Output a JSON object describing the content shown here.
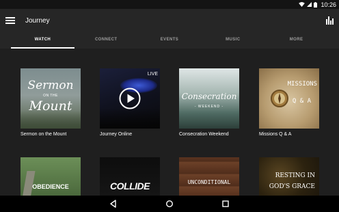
{
  "status_bar": {
    "time": "10:26"
  },
  "app_bar": {
    "title": "Journey"
  },
  "tabs": [
    {
      "label": "WATCH",
      "active": true
    },
    {
      "label": "CONNECT",
      "active": false
    },
    {
      "label": "EVENTS",
      "active": false
    },
    {
      "label": "MUSIC",
      "active": false
    },
    {
      "label": "MORE",
      "active": false
    }
  ],
  "cards": [
    {
      "label": "Sermon on the Mount",
      "art": {
        "line1": "Sermon",
        "line2": "ON THE",
        "line3": "Mount"
      }
    },
    {
      "label": "Journey Online",
      "art": {
        "live": "LIVE"
      }
    },
    {
      "label": "Consecration Weekend",
      "art": {
        "line1": "Consecration",
        "line2": "- WEEKEND -"
      }
    },
    {
      "label": "Missions Q & A",
      "art": {
        "line1": "MISSIONS",
        "line2": "Q & A"
      }
    },
    {
      "label": "",
      "art": {
        "line1": "OBEDIENCE"
      }
    },
    {
      "label": "",
      "art": {
        "line1": "COLLIDE"
      }
    },
    {
      "label": "",
      "art": {
        "line1": "UNCONDITIONAL"
      }
    },
    {
      "label": "",
      "art": {
        "line1": "RESTING IN",
        "line2": "GOD'S GRACE"
      }
    }
  ],
  "colors": {
    "background": "#1f1f1f",
    "app_bar": "#262626",
    "tab_inactive": "#9e9e9e",
    "tab_active": "#ffffff"
  },
  "icons": {
    "menu": "hamburger-icon",
    "chart": "bar-chart-icon",
    "play": "play-icon",
    "nav_back": "back-triangle-icon",
    "nav_home": "home-circle-icon",
    "nav_recents": "recents-square-icon"
  }
}
